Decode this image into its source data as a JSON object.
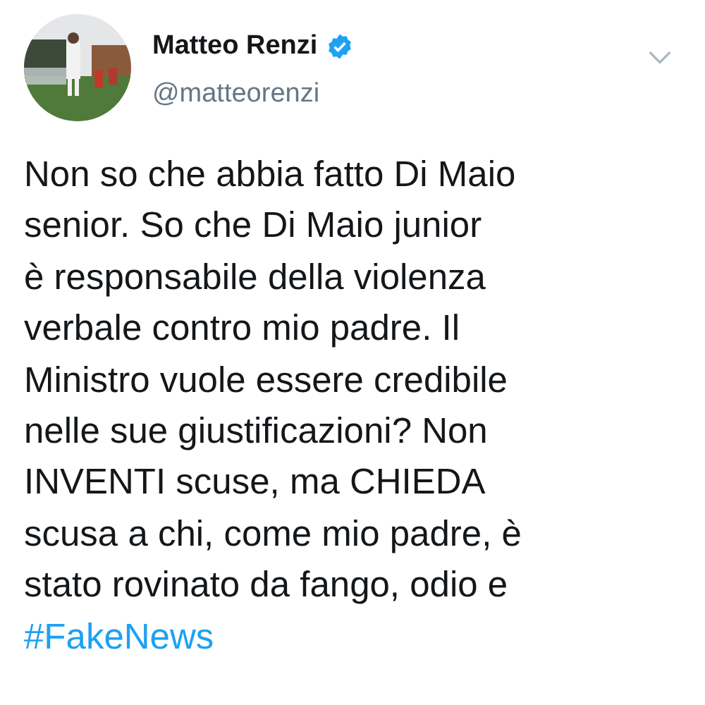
{
  "author": {
    "name": "Matteo Renzi",
    "verified": true,
    "handle": "@matteorenzi"
  },
  "tweet": {
    "lines": [
      "Non so che abbia fatto Di Maio",
      "senior. So che Di Maio junior",
      "è responsabile della violenza",
      "verbale contro mio padre. Il",
      "Ministro vuole essere credibile",
      "nelle sue giustificazioni? Non",
      "INVENTI scuse, ma CHIEDA",
      "scusa a chi, come mio padre, è",
      "stato rovinato da fango, odio e"
    ],
    "hashtag": "#FakeNews"
  }
}
